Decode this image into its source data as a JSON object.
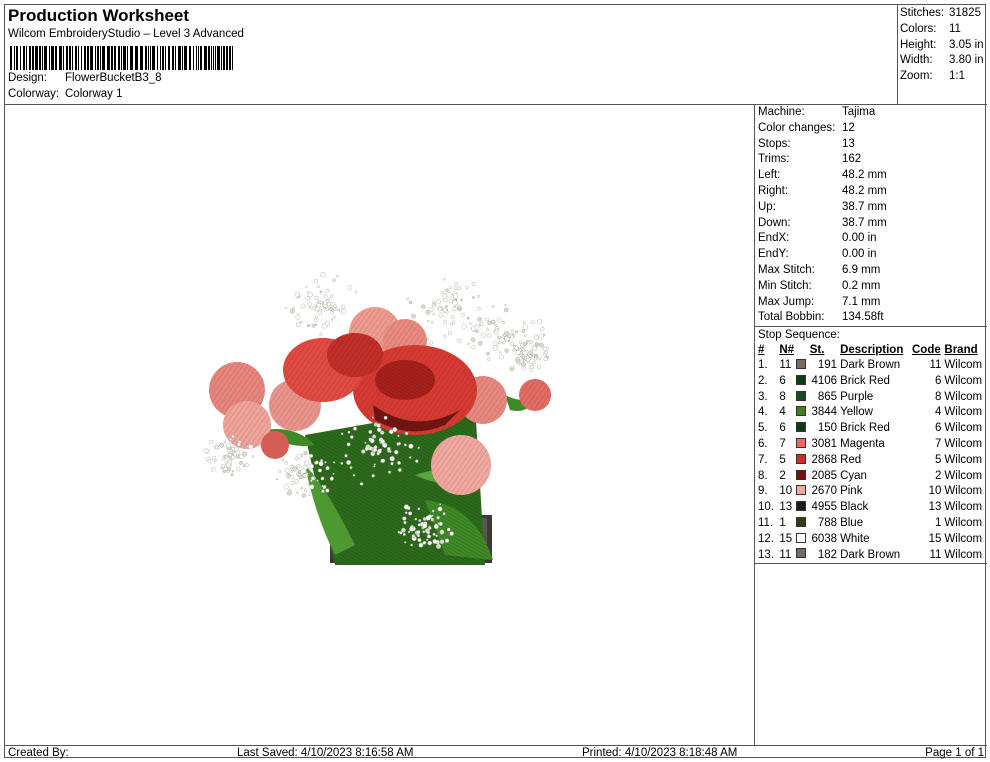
{
  "header": {
    "title": "Production Worksheet",
    "subtitle": "Wilcom EmbroideryStudio – Level 3 Advanced",
    "design_label": "Design:",
    "design_value": "FlowerBucketB3_8",
    "colorway_label": "Colorway:",
    "colorway_value": "Colorway 1"
  },
  "summary": [
    {
      "label": "Stitches:",
      "value": "31825"
    },
    {
      "label": "Colors:",
      "value": "11"
    },
    {
      "label": "Height:",
      "value": "3.05 in"
    },
    {
      "label": "Width:",
      "value": "3.80 in"
    },
    {
      "label": "Zoom:",
      "value": "1:1"
    }
  ],
  "machine": [
    {
      "label": "Machine:",
      "value": "Tajima"
    },
    {
      "label": "Color changes:",
      "value": "12"
    },
    {
      "label": "Stops:",
      "value": "13"
    },
    {
      "label": "Trims:",
      "value": "162"
    },
    {
      "label": "Left:",
      "value": "48.2 mm"
    },
    {
      "label": "Right:",
      "value": "48.2 mm"
    },
    {
      "label": "Up:",
      "value": "38.7 mm"
    },
    {
      "label": "Down:",
      "value": "38.7 mm"
    },
    {
      "label": "EndX:",
      "value": "0.00 in"
    },
    {
      "label": "EndY:",
      "value": "0.00 in"
    },
    {
      "label": "Max Stitch:",
      "value": "6.9 mm"
    },
    {
      "label": "Min Stitch:",
      "value": "0.2 mm"
    },
    {
      "label": "Max Jump:",
      "value": "7.1 mm"
    },
    {
      "label": "Total Bobbin:",
      "value": "134.58ft"
    }
  ],
  "stop_sequence": {
    "title": "Stop Sequence:",
    "headers": {
      "idx": "#",
      "n": "N#",
      "st": "St.",
      "desc": "Description",
      "code": "Code",
      "brand": "Brand"
    },
    "rows": [
      {
        "idx": "1.",
        "n": "11",
        "color": "#7a6a60",
        "st": "191",
        "desc": "Dark Brown",
        "code": "11",
        "brand": "Wilcom"
      },
      {
        "idx": "2.",
        "n": "6",
        "color": "#0f3d12",
        "st": "4106",
        "desc": "Brick Red",
        "code": "6",
        "brand": "Wilcom"
      },
      {
        "idx": "3.",
        "n": "8",
        "color": "#1d4d1f",
        "st": "865",
        "desc": "Purple",
        "code": "8",
        "brand": "Wilcom"
      },
      {
        "idx": "4.",
        "n": "4",
        "color": "#3f7d1f",
        "st": "3844",
        "desc": "Yellow",
        "code": "4",
        "brand": "Wilcom"
      },
      {
        "idx": "5.",
        "n": "6",
        "color": "#0f3d12",
        "st": "150",
        "desc": "Brick Red",
        "code": "6",
        "brand": "Wilcom"
      },
      {
        "idx": "6.",
        "n": "7",
        "color": "#f0665f",
        "st": "3081",
        "desc": "Magenta",
        "code": "7",
        "brand": "Wilcom"
      },
      {
        "idx": "7.",
        "n": "5",
        "color": "#d42a2a",
        "st": "2868",
        "desc": "Red",
        "code": "5",
        "brand": "Wilcom"
      },
      {
        "idx": "8.",
        "n": "2",
        "color": "#7a0d10",
        "st": "2085",
        "desc": "Cyan",
        "code": "2",
        "brand": "Wilcom"
      },
      {
        "idx": "9.",
        "n": "10",
        "color": "#f2a9a2",
        "st": "2670",
        "desc": "Pink",
        "code": "10",
        "brand": "Wilcom"
      },
      {
        "idx": "10.",
        "n": "13",
        "color": "#1e1a18",
        "st": "4955",
        "desc": "Black",
        "code": "13",
        "brand": "Wilcom"
      },
      {
        "idx": "11.",
        "n": "1",
        "color": "#3a3a10",
        "st": "788",
        "desc": "Blue",
        "code": "1",
        "brand": "Wilcom"
      },
      {
        "idx": "12.",
        "n": "15",
        "color": "#ffffff",
        "st": "6038",
        "desc": "White",
        "code": "15",
        "brand": "Wilcom"
      },
      {
        "idx": "13.",
        "n": "11",
        "color": "#7a6a60",
        "st": "182",
        "desc": "Dark Brown",
        "code": "11",
        "brand": "Wilcom"
      }
    ]
  },
  "footer": {
    "created": "Created By:",
    "saved": "Last Saved: 4/10/2023 8:16:58 AM",
    "printed": "Printed: 4/10/2023 8:18:48 AM",
    "page": "Page 1 of 1"
  }
}
